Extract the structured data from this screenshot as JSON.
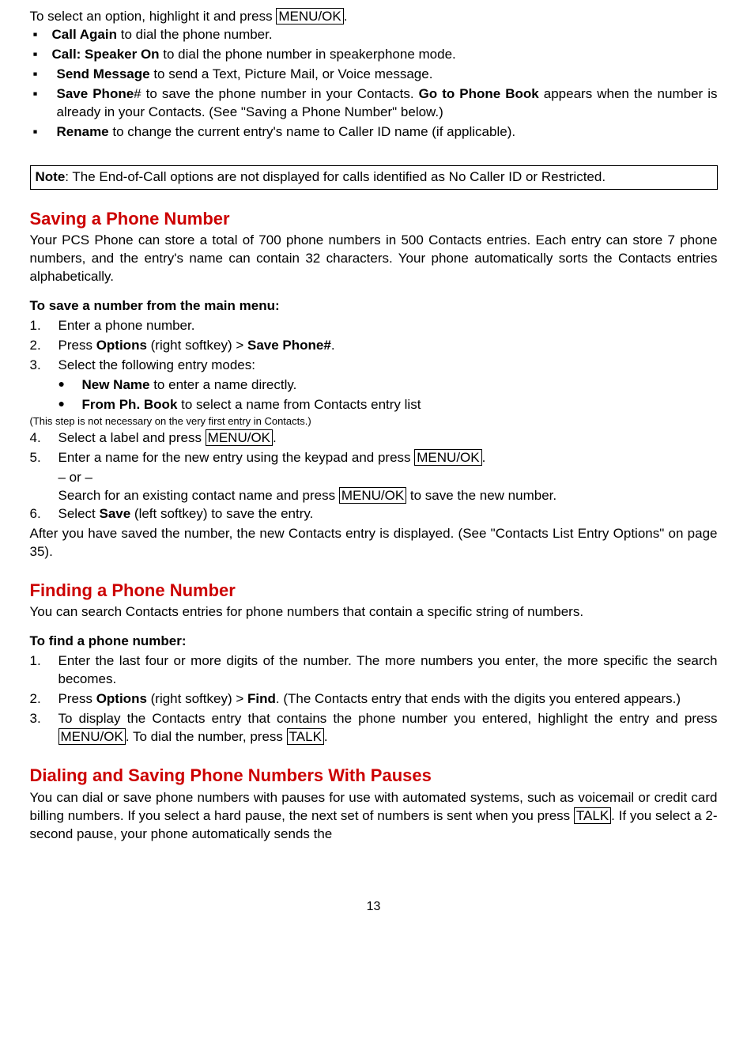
{
  "intro_line": [
    "To select an option, highlight it and press ",
    "MENU/OK",
    "."
  ],
  "options": [
    {
      "bold": "Call Again",
      "text": " to dial the phone number."
    },
    {
      "bold": "Call: Speaker On",
      "text": " to dial the phone number in speakerphone mode."
    },
    {
      "bold": "Send Message",
      "text": " to send a Text, Picture Mail, or Voice message."
    },
    {
      "bold": "Save Phone",
      "hash": "#",
      "text": " to save the phone number in your Contacts. ",
      "bold2": "Go to Phone Book",
      "text2": " appears when the number is already in your Contacts. (See \"Saving a Phone Number\" below.)"
    },
    {
      "bold": "Rename",
      "text": " to change the current entry's name to Caller ID name (if applicable)."
    }
  ],
  "note": {
    "label": "Note",
    "text": ": The End-of-Call options are not displayed for calls identified as No Caller ID or Restricted."
  },
  "section1": {
    "title": "Saving a Phone Number",
    "para": "Your PCS Phone can store a total of 700 phone numbers in 500 Contacts entries. Each entry can store 7 phone numbers, and the entry's name can contain 32 characters. Your phone automatically sorts the Contacts entries alphabetically.",
    "subhead": "To save a number from the main menu:",
    "steps": {
      "s1": "Enter a phone number.",
      "s2a": "Press ",
      "s2b": "Options",
      "s2c": " (right softkey) > ",
      "s2d": "Save Phone#",
      "s2e": ".",
      "s3": "Select the following entry modes:",
      "sb1a": "New Name",
      "sb1b": " to enter a name directly.",
      "sb2a": "From Ph. Book",
      "sb2b": " to select a name from Contacts entry list",
      "small": "(This step is not necessary on the very first entry in Contacts.)",
      "s4a": "Select a label and press ",
      "s4b": "MENU/OK",
      "s4c": ".",
      "s5a": "Enter a name for the new entry using the keypad and press ",
      "s5b": "MENU/OK",
      "s5c": ".",
      "or": "– or –",
      "s5d": "Search for an existing contact name and press ",
      "s5e": "MENU/OK",
      "s5f": " to save the new number.",
      "s6a": "Select ",
      "s6b": "Save",
      "s6c": " (left softkey) to save the entry."
    },
    "after": "After you have saved the number, the new Contacts entry is displayed. (See \"Contacts List Entry Options\" on page 35)."
  },
  "section2": {
    "title": "Finding a Phone Number",
    "para": "You can search Contacts entries for phone numbers that contain a specific string of numbers.",
    "subhead": "To find a phone number:",
    "s1": "Enter the last four or more digits of the number. The more numbers you enter, the more specific the search becomes.",
    "s2a": "Press ",
    "s2b": "Options",
    "s2c": " (right softkey) > ",
    "s2d": "Find",
    "s2e": ". (The Contacts entry that ends with the digits you entered appears.)",
    "s3a": "To display the Contacts entry that contains the phone number you entered, highlight the entry and press ",
    "s3b": "MENU/OK",
    "s3c": ". To dial the number, press ",
    "s3d": "TALK",
    "s3e": "."
  },
  "section3": {
    "title": "Dialing and Saving Phone Numbers With Pauses",
    "para_a": "You can dial or save phone numbers with pauses for use with automated systems, such as voicemail or credit card billing numbers. If you select a hard pause, the next set of numbers is sent when you press ",
    "para_b": "TALK",
    "para_c": ". If you select a 2-second pause, your phone automatically sends the"
  },
  "page": "13"
}
